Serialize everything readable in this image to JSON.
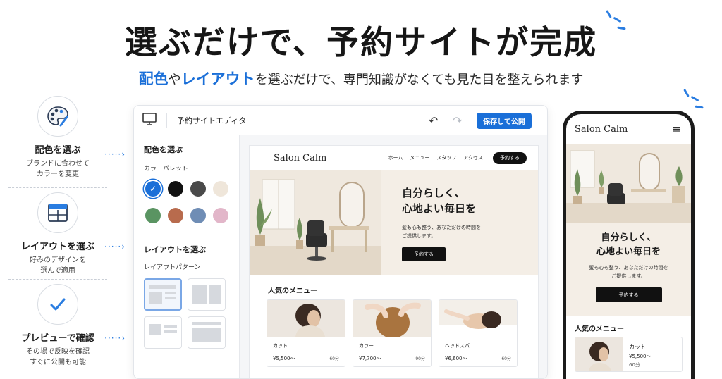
{
  "hero": {
    "title": "選ぶだけで、予約サイトが完成",
    "subtitle_part1": "配色",
    "subtitle_part2": "や",
    "subtitle_part3": "レイアウト",
    "subtitle_part4": "を選ぶだけで、専門知識がなくても見た目を整えられます"
  },
  "features": [
    {
      "icon": "palette-icon",
      "title": "配色を選ぶ",
      "desc1": "ブランドに合わせて",
      "desc2": "カラーを変更",
      "arrow": "·····›"
    },
    {
      "icon": "layout-icon",
      "title": "レイアウトを選ぶ",
      "desc1": "好みのデザインを",
      "desc2": "選んで適用",
      "arrow": "·····›"
    },
    {
      "icon": "check-icon",
      "title": "プレビューで確認",
      "desc1": "その場で反映を確認",
      "desc2": "すぐに公開も可能",
      "arrow": "·····›"
    }
  ],
  "editor": {
    "title": "予約サイトエディタ",
    "undo": "↶",
    "redo": "↷",
    "save_label": "保存して公開",
    "color_heading": "配色を選ぶ",
    "palette_label": "カラーパレット",
    "swatches": [
      "#1a6fd8",
      "#111111",
      "#4a4a4a",
      "#efe6da",
      "#5a9462",
      "#b86b4d",
      "#6f8db5",
      "#e2b6c9"
    ],
    "selected_swatch_mark": "✓",
    "layout_heading": "レイアウトを選ぶ",
    "layout_label": "レイアウトパターン"
  },
  "site": {
    "logo": "Salon Calm",
    "nav": [
      "ホーム",
      "メニュー",
      "スタッフ",
      "アクセス"
    ],
    "reserve": "予約する",
    "hero_line1": "自分らしく、",
    "hero_line2": "心地よい毎日を",
    "hero_text1": "髪も心も整う、あなただけの時間を",
    "hero_text2": "ご提供します。",
    "hero_button": "予約する",
    "menu_title": "人気のメニュー",
    "menu": [
      {
        "name": "カット",
        "price": "¥5,500〜",
        "duration": "60分"
      },
      {
        "name": "カラー",
        "price": "¥7,700〜",
        "duration": "90分"
      },
      {
        "name": "ヘッドスパ",
        "price": "¥6,600〜",
        "duration": "60分"
      }
    ]
  },
  "phone": {
    "logo": "Salon Calm",
    "menu_icon": "≡",
    "hero_line1": "自分らしく、",
    "hero_line2": "心地よい毎日を",
    "hero_text1": "髪も心も整う、あなただけの時間を",
    "hero_text2": "ご提供します。",
    "hero_button": "予約する",
    "menu_title": "人気のメニュー",
    "card": {
      "name": "カット",
      "price": "¥5,500〜",
      "duration": "60分"
    }
  }
}
